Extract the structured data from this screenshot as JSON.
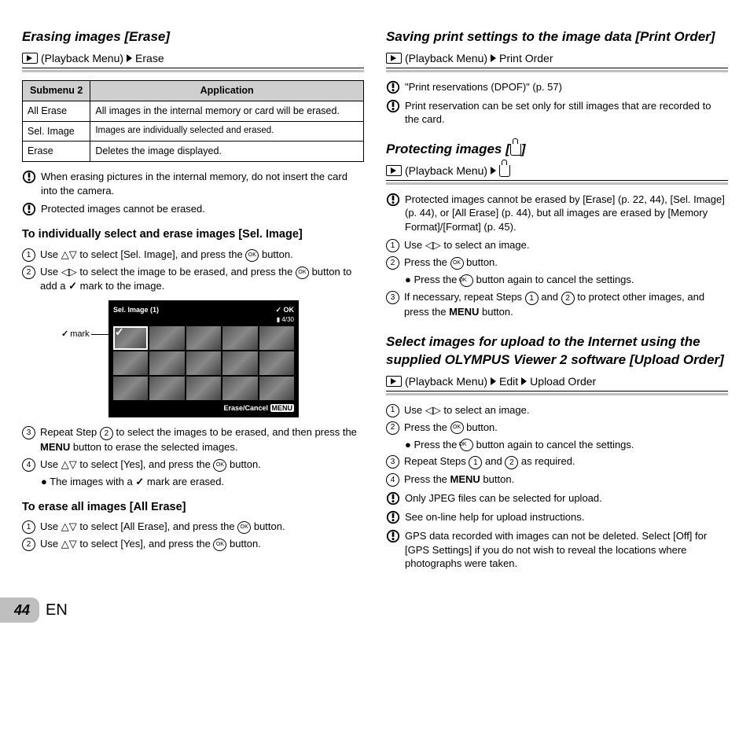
{
  "left": {
    "h_erase": "Erasing images [Erase]",
    "crumb_erase_a": "(Playback Menu)",
    "crumb_erase_b": "Erase",
    "table": {
      "th1": "Submenu 2",
      "th2": "Application",
      "r1a": "All Erase",
      "r1b": "All images in the internal memory or card will be erased.",
      "r2a": "Sel. Image",
      "r2b": "Images are individually selected and erased.",
      "r3a": "Erase",
      "r3b": "Deletes the image displayed."
    },
    "note1": "When erasing pictures in the internal memory, do not insert the card into the camera.",
    "note2": "Protected images cannot be erased.",
    "h_sel": "To individually select and erase images [Sel. Image]",
    "sel1a": "Use ",
    "sel1b": " to select [Sel. Image], and press the ",
    "sel1c": " button.",
    "sel2a": "Use ",
    "sel2b": " to select the image to be erased, and press the ",
    "sel2c": " button to add a ",
    "sel2d": " mark to the image.",
    "lcd_title": "Sel. Image (1)",
    "lcd_ok": "OK",
    "lcd_count": "4/30",
    "lcd_bot": "Erase/Cancel",
    "lcd_menu": "MENU",
    "lcd_mark": "mark",
    "sel3a": "Repeat Step ",
    "sel3b": " to select the images to be erased, and then press the ",
    "sel3_menu": "MENU",
    "sel3c": " button to erase the selected images.",
    "sel4a": "Use ",
    "sel4b": " to select [Yes], and press the ",
    "sel4c": " button.",
    "sel4_bullet": "The images with a ",
    "sel4_bullet2": " mark are erased.",
    "h_all": "To erase all images [All Erase]",
    "all1a": "Use ",
    "all1b": " to select [All Erase], and press the ",
    "all1c": " button.",
    "all2a": "Use ",
    "all2b": " to select [Yes], and press the ",
    "all2c": " button."
  },
  "right": {
    "h_print": "Saving print settings to the image data [Print Order]",
    "crumb_print_a": "(Playback Menu)",
    "crumb_print_b": "Print Order",
    "p_note1": "\"Print reservations (DPOF)\" (p. 57)",
    "p_note2": "Print reservation can be set only for still images that are recorded to the card.",
    "h_protect": "Protecting images [",
    "h_protect2": "]",
    "crumb_prot_a": "(Playback Menu)",
    "prot_note": "Protected images cannot be erased by [Erase] (p. 22, 44), [Sel. Image] (p. 44), or [All Erase] (p. 44), but all images are erased by [Memory Format]/[Format] (p. 45).",
    "prot1a": "Use ",
    "prot1b": " to select an image.",
    "prot2a": "Press the ",
    "prot2b": " button.",
    "prot2_bullet": "Press the ",
    "prot2_bullet2": " button again to cancel the settings.",
    "prot3a": "If necessary, repeat Steps ",
    "prot3b": " and ",
    "prot3c": " to protect other images, and press the ",
    "prot3_menu": "MENU",
    "prot3d": " button.",
    "h_upload": "Select images for upload to the Internet using the supplied OLYMPUS Viewer 2 software [Upload Order]",
    "crumb_up_a": "(Playback Menu)",
    "crumb_up_b": "Edit",
    "crumb_up_c": "Upload Order",
    "up1a": "Use ",
    "up1b": " to select an image.",
    "up2a": "Press the ",
    "up2b": " button.",
    "up2_bullet": "Press the ",
    "up2_bullet2": " button again to cancel the settings.",
    "up3a": "Repeat Steps ",
    "up3b": " and ",
    "up3c": " as required.",
    "up4a": "Press the ",
    "up4_menu": "MENU",
    "up4b": " button.",
    "up_note1": "Only JPEG files can be selected for upload.",
    "up_note2": "See on-line help for upload instructions.",
    "up_note3": "GPS data recorded with images can not be deleted. Select [Off] for [GPS Settings] if you do not wish to reveal the locations where photographs were taken."
  },
  "footer": {
    "page": "44",
    "lang": "EN"
  }
}
